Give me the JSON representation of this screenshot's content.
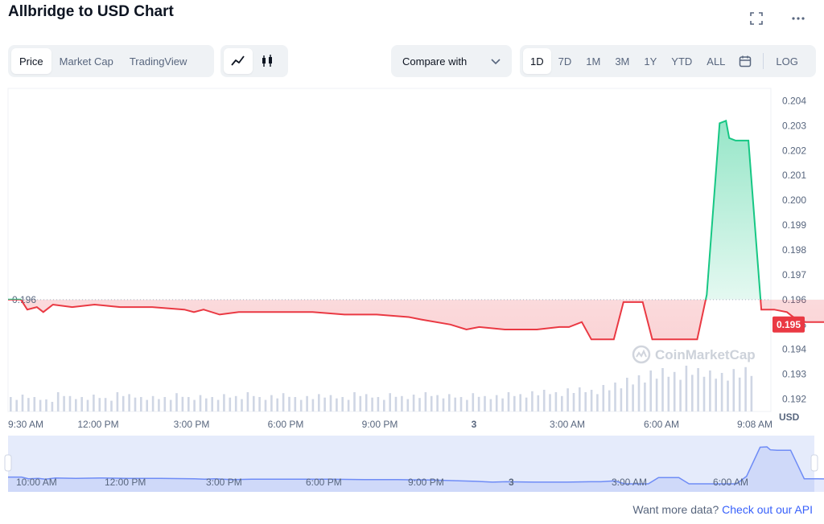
{
  "title": "Allbridge to USD Chart",
  "top_icons": [
    "fullscreen-icon",
    "more-icon"
  ],
  "view_tabs": [
    {
      "label": "Price",
      "active": true
    },
    {
      "label": "Market Cap",
      "active": false
    },
    {
      "label": "TradingView",
      "active": false
    }
  ],
  "chart_style_icons": [
    "line-chart-icon",
    "candlestick-icon"
  ],
  "compare": {
    "label": "Compare with"
  },
  "ranges": [
    {
      "label": "1D",
      "active": true
    },
    {
      "label": "7D",
      "active": false
    },
    {
      "label": "1M",
      "active": false
    },
    {
      "label": "3M",
      "active": false
    },
    {
      "label": "1Y",
      "active": false
    },
    {
      "label": "YTD",
      "active": false
    },
    {
      "label": "ALL",
      "active": false
    }
  ],
  "log_label": "LOG",
  "footer": {
    "text": "Want more data?",
    "link": "Check out our API"
  },
  "watermark": "CoinMarketCap",
  "colors": {
    "up": "#16c784",
    "down": "#ea3943",
    "volume": "#cfd6e4",
    "navigator": "#6f8cf6"
  },
  "chart_data": {
    "type": "area",
    "currency": "USD",
    "ylim": [
      0.1915,
      0.2045
    ],
    "y_ticks": [
      "0.204",
      "0.203",
      "0.202",
      "0.201",
      "0.200",
      "0.199",
      "0.198",
      "0.197",
      "0.196",
      "0.195",
      "0.194",
      "0.193",
      "0.192"
    ],
    "x_ticks": [
      "9:30 AM",
      "12:00 PM",
      "3:00 PM",
      "6:00 PM",
      "9:00 PM",
      "3",
      "3:00 AM",
      "6:00 AM",
      "9:08 AM"
    ],
    "x_tick_hours": [
      9.5,
      12,
      15,
      18,
      21,
      24,
      27,
      30,
      33.13
    ],
    "x_range_hours": [
      9.5,
      33.3
    ],
    "open_price": 0.196,
    "open_label": "0.196",
    "current_price": 0.195,
    "current_label": "0.195",
    "price_series": [
      [
        9.5,
        0.196
      ],
      [
        9.9,
        0.196
      ],
      [
        10.1,
        0.1956
      ],
      [
        10.4,
        0.1957
      ],
      [
        10.6,
        0.1955
      ],
      [
        10.9,
        0.1958
      ],
      [
        11.5,
        0.1957
      ],
      [
        12.2,
        0.1958
      ],
      [
        13.0,
        0.1957
      ],
      [
        14.0,
        0.1957
      ],
      [
        15.0,
        0.1956
      ],
      [
        15.3,
        0.1955
      ],
      [
        15.6,
        0.1956
      ],
      [
        16.1,
        0.1954
      ],
      [
        16.7,
        0.1955
      ],
      [
        17.3,
        0.1955
      ],
      [
        18.0,
        0.1955
      ],
      [
        19.0,
        0.1955
      ],
      [
        20.0,
        0.1954
      ],
      [
        21.0,
        0.1954
      ],
      [
        22.0,
        0.1953
      ],
      [
        22.4,
        0.1952
      ],
      [
        23.3,
        0.195
      ],
      [
        23.8,
        0.1948
      ],
      [
        24.2,
        0.1949
      ],
      [
        25.0,
        0.1948
      ],
      [
        26.0,
        0.1948
      ],
      [
        26.7,
        0.1949
      ],
      [
        27.0,
        0.1949
      ],
      [
        27.4,
        0.1951
      ],
      [
        27.7,
        0.1944
      ],
      [
        28.4,
        0.1944
      ],
      [
        28.7,
        0.1959
      ],
      [
        29.3,
        0.1959
      ],
      [
        29.6,
        0.1944
      ],
      [
        30.5,
        0.1944
      ],
      [
        31.0,
        0.1944
      ],
      [
        31.3,
        0.1962
      ],
      [
        31.7,
        0.2031
      ],
      [
        31.9,
        0.2032
      ],
      [
        32.0,
        0.2025
      ],
      [
        32.2,
        0.2024
      ],
      [
        32.6,
        0.2024
      ],
      [
        33.0,
        0.1956
      ],
      [
        33.4,
        0.1956
      ],
      [
        33.8,
        0.1955
      ],
      [
        34.2,
        0.1951
      ],
      [
        35.0,
        0.1951
      ],
      [
        35.4,
        0.195
      ],
      [
        35.7,
        0.1954
      ],
      [
        36.0,
        0.195
      ],
      [
        36.4,
        0.1951
      ],
      [
        36.8,
        0.1949
      ],
      [
        37.0,
        0.1953
      ],
      [
        37.2,
        0.195
      ]
    ],
    "volume_levels": [
      0.3,
      0.35,
      0.3,
      0.25,
      0.4,
      0.32,
      0.3,
      0.35,
      0.28,
      0.4,
      0.36,
      0.3,
      0.32,
      0.3,
      0.38,
      0.3,
      0.34,
      0.3,
      0.36,
      0.32,
      0.4,
      0.3,
      0.34,
      0.38,
      0.3,
      0.32,
      0.36,
      0.34,
      0.3,
      0.4,
      0.36,
      0.3,
      0.38,
      0.32,
      0.35,
      0.4,
      0.34,
      0.36,
      0.3,
      0.38,
      0.32,
      0.34,
      0.4,
      0.36,
      0.42,
      0.45,
      0.4,
      0.48,
      0.5,
      0.45,
      0.55,
      0.6,
      0.7,
      0.75,
      0.85,
      0.9,
      0.82,
      0.95,
      0.9,
      0.85,
      0.8,
      0.88,
      0.92
    ],
    "navigator_ticks": [
      "10:00 AM",
      "12:00 PM",
      "3:00 PM",
      "6:00 PM",
      "9:00 PM",
      "3",
      "3:00 AM",
      "6:00 AM"
    ],
    "navigator_tick_hours": [
      10,
      12,
      15,
      18,
      21,
      24,
      27,
      30
    ]
  }
}
